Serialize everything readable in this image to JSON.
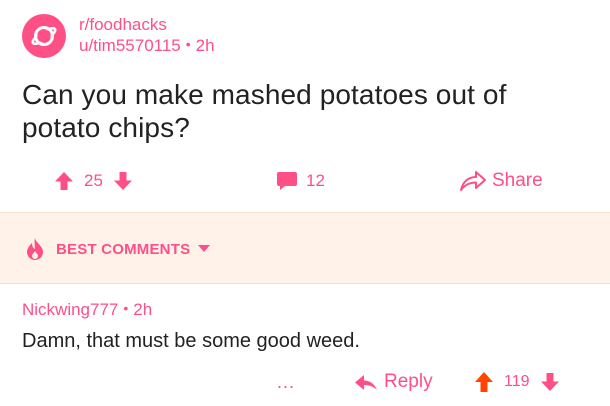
{
  "post": {
    "subreddit": "r/foodhacks",
    "author": "u/tim5570115",
    "separator": "•",
    "age": "2h",
    "title": "Can you make mashed potatoes out of potato chips?",
    "upvotes": "25",
    "comments": "12",
    "share_label": "Share"
  },
  "best_comments": {
    "label": "BEST COMMENTS"
  },
  "comment": {
    "author": "Nickwing777",
    "separator": "•",
    "age": "2h",
    "body": "Damn, that must be some good weed.",
    "more_label": "...",
    "reply_label": "Reply",
    "score": "119"
  },
  "colors": {
    "accent": "#ff4f87",
    "upvote_active": "#ff4500",
    "best_bar_bg": "#fff2e8"
  },
  "icons": {
    "avatar": "planet-icon",
    "upvote": "upvote-arrow-icon",
    "downvote": "downvote-arrow-icon",
    "comment": "speech-bubble-icon",
    "share": "share-arrow-icon",
    "best": "flame-icon",
    "reply": "reply-arrow-icon"
  }
}
